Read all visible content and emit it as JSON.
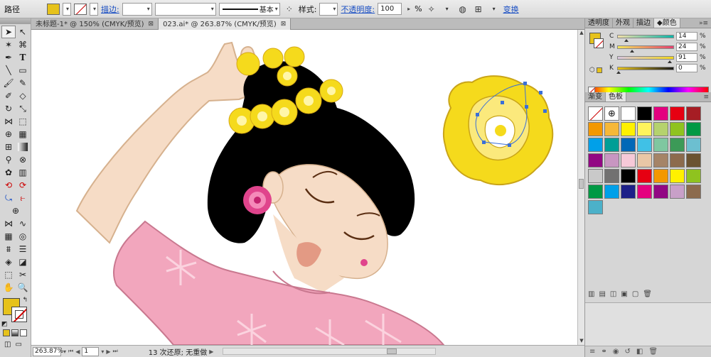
{
  "control_bar": {
    "object_type": "路径",
    "fill_color": "#e6c21b",
    "stroke_label": "描边:",
    "line_style_label": "基本",
    "style_label": "样式:",
    "opacity_label": "不透明度:",
    "opacity_value": "100",
    "opacity_unit": "%",
    "transform_label": "变换"
  },
  "tabs": [
    {
      "label": "未标题-1* @ 150% (CMYK/预览)",
      "close": "⊠"
    },
    {
      "label": "023.ai* @ 263.87% (CMYK/预览)",
      "close": "⊠"
    }
  ],
  "status_bar": {
    "zoom": "263.87%",
    "artboard": "1",
    "message": "13 次还原; 无重做"
  },
  "color_panel": {
    "tabs": [
      "透明度",
      "外观",
      "描边",
      "颜色"
    ],
    "active_tab": "颜色",
    "fill_color": "#e6c21b",
    "channels": [
      {
        "name": "C",
        "value": "14",
        "unit": "%",
        "level": 0.14
      },
      {
        "name": "M",
        "value": "24",
        "unit": "%",
        "level": 0.24
      },
      {
        "name": "Y",
        "value": "91",
        "unit": "%",
        "level": 0.91
      },
      {
        "name": "K",
        "value": "0",
        "unit": "%",
        "level": 0.0
      }
    ]
  },
  "swatches_panel": {
    "tabs": [
      "渐变",
      "色板"
    ],
    "active_tab": "色板",
    "colors": [
      "none",
      "registration",
      "#ffffff",
      "#000000",
      "#e4007f",
      "#e60012",
      "#a61d24",
      "#f39800",
      "#f6b838",
      "#fff100",
      "#fff45c",
      "#b5d26d",
      "#8fc31f",
      "#009944",
      "#00a0e9",
      "#009e96",
      "#0068b7",
      "#40c1e6",
      "#7fc7a0",
      "#3c9a57",
      "#6cbfd0",
      "#920783",
      "#c896c1",
      "#f6c9d8",
      "#e9c7a6",
      "#a58467",
      "#8c6b4d",
      "#6b5331",
      "#c9c9c9",
      "#727171",
      "#000000",
      "#e60012",
      "#f39800",
      "#fff100",
      "#8fc31f",
      "#009944",
      "#00a0e9",
      "#1d2088",
      "#e4007f",
      "#920783",
      "#c8a0c8",
      "#8c6b4d",
      "#4cb1c9"
    ]
  },
  "canvas": {
    "skin": "#f6dcc6",
    "hair": "#000000",
    "dress": "#f2a6bd",
    "flower_yellow": "#f5da1c",
    "flower_pink": "#e0448c"
  }
}
